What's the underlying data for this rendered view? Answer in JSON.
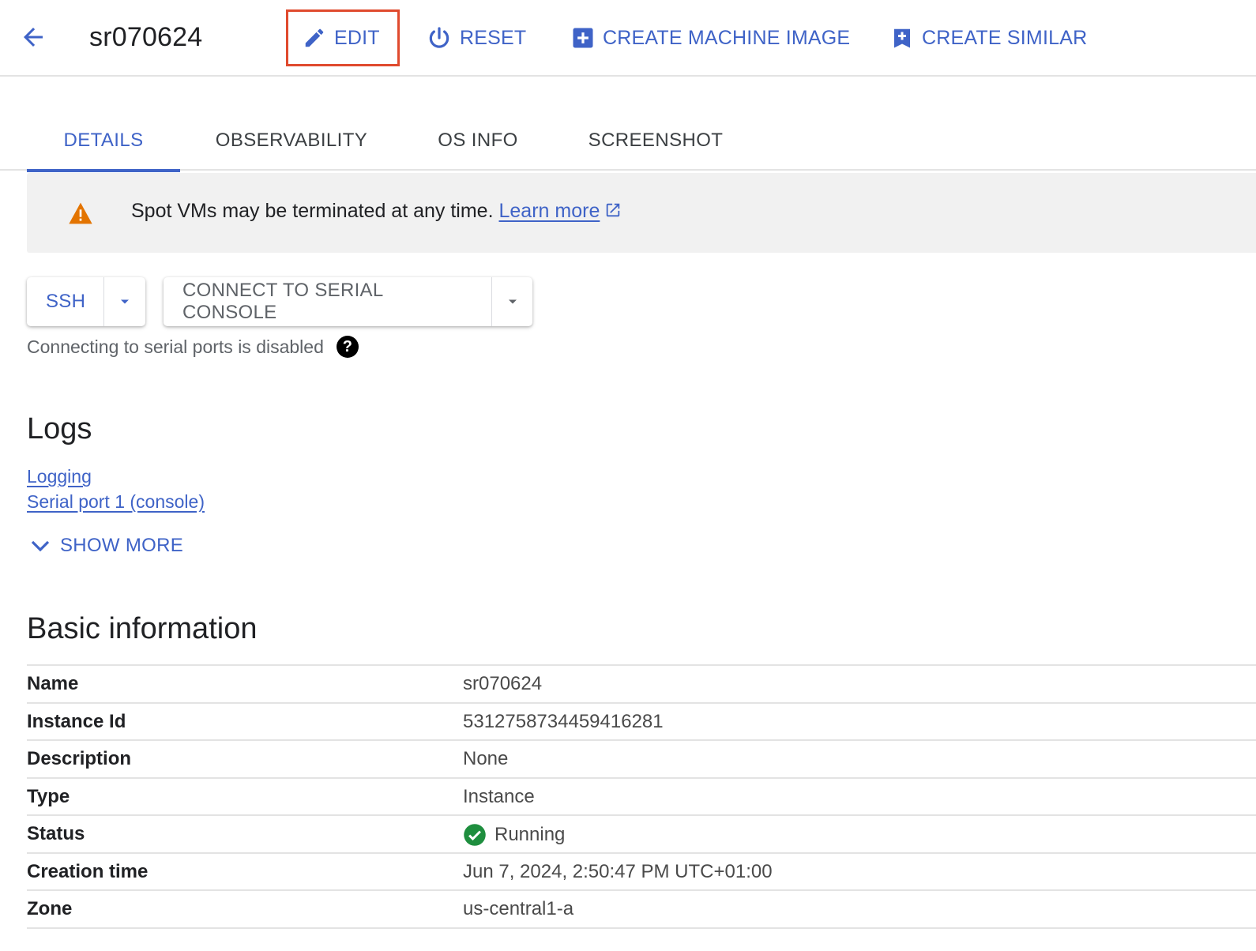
{
  "header": {
    "title": "sr070624",
    "actions": {
      "edit": "EDIT",
      "reset": "RESET",
      "create_machine_image": "CREATE MACHINE IMAGE",
      "create_similar": "CREATE SIMILAR"
    }
  },
  "tabs": [
    {
      "label": "DETAILS",
      "active": true
    },
    {
      "label": "OBSERVABILITY",
      "active": false
    },
    {
      "label": "OS INFO",
      "active": false
    },
    {
      "label": "SCREENSHOT",
      "active": false
    }
  ],
  "alert": {
    "message": "Spot VMs may be terminated at any time.",
    "link": "Learn more",
    "icon": "warning-icon"
  },
  "connect": {
    "ssh_label": "SSH",
    "serial_label": "CONNECT TO SERIAL CONSOLE",
    "hint": "Connecting to serial ports is disabled",
    "help_glyph": "?"
  },
  "logs": {
    "title": "Logs",
    "links": [
      "Logging",
      "Serial port 1 (console)"
    ],
    "show_more": "SHOW MORE"
  },
  "basic_info": {
    "title": "Basic information",
    "rows": [
      {
        "key": "Name",
        "value": "sr070624"
      },
      {
        "key": "Instance Id",
        "value": "5312758734459416281"
      },
      {
        "key": "Description",
        "value": "None"
      },
      {
        "key": "Type",
        "value": "Instance"
      },
      {
        "key": "Status",
        "value": "Running"
      },
      {
        "key": "Creation time",
        "value": "Jun 7, 2024, 2:50:47 PM UTC+01:00"
      },
      {
        "key": "Zone",
        "value": "us-central1-a"
      }
    ]
  },
  "colors": {
    "accent": "#3f63c7",
    "warning": "#e37400",
    "success": "#1e8e3e",
    "highlight": "#e04a2e"
  }
}
